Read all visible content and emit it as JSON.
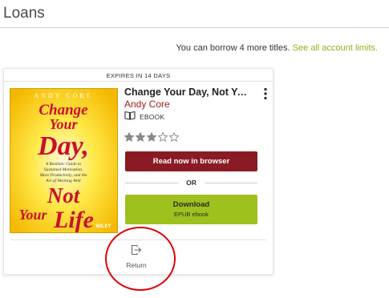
{
  "page": {
    "title": "Loans"
  },
  "limits": {
    "message": "You can borrow 4 more titles.",
    "link_label": "See all account limits."
  },
  "loan": {
    "expires_label": "EXPIRES IN 14 DAYS",
    "title": "Change Your Day, Not Your Life",
    "author": "Andy Core",
    "format_icon": "open-book-icon",
    "format": "EBOOK",
    "rating": {
      "value": 3,
      "max": 5
    },
    "read_button": "Read now in browser",
    "or_label": "OR",
    "download_button": "Download",
    "download_format": "EPUB ebook",
    "return_icon": "return-arrow-icon",
    "return_label": "Return",
    "cover": {
      "author_line": "ANDY CORE",
      "title_lines": [
        "Change",
        "Your",
        "Day,",
        "Not",
        "Your",
        "Life"
      ],
      "subtitle_lines": [
        "A Realistic Guide to",
        "Sustained Motivation,",
        "More Productivity, and the",
        "Art of Working Well"
      ],
      "publisher": "WILEY"
    }
  },
  "colors": {
    "accent_green": "#9ec11d",
    "link_green": "#8cb31e",
    "read_button": "#8a1b24",
    "author_red": "#9d1a1a",
    "annotation_red": "#e00000",
    "cover_yellow": "#ffd500",
    "cover_red": "#c8102e"
  }
}
